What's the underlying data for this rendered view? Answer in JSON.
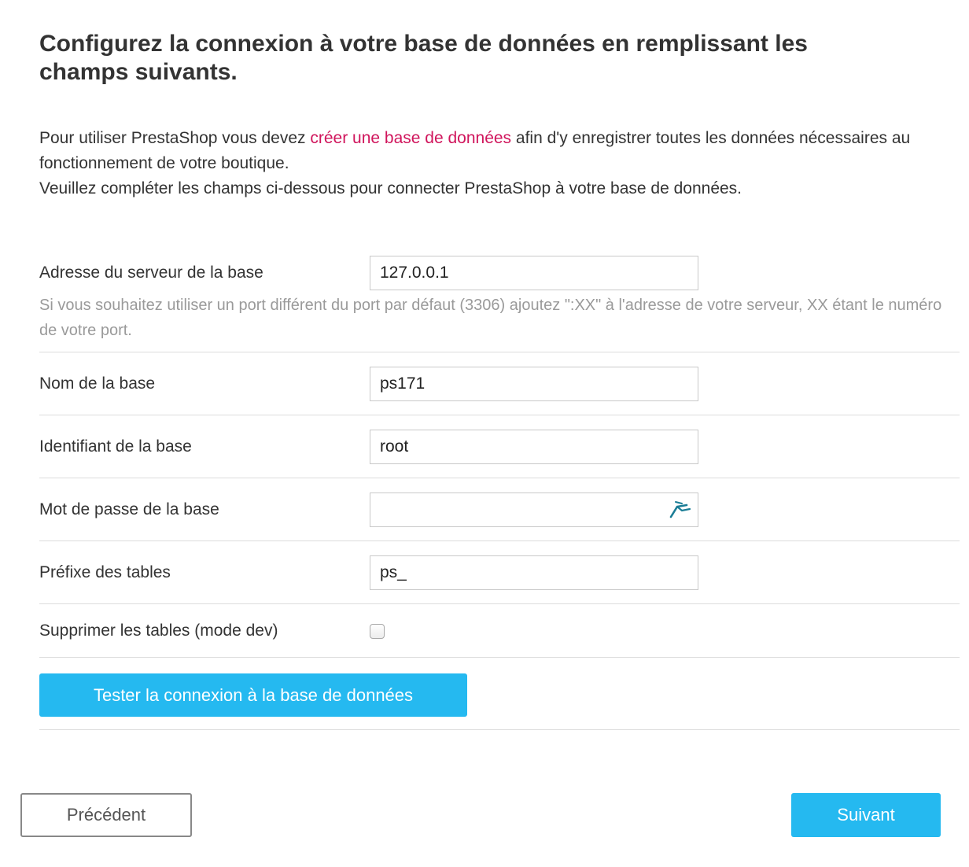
{
  "heading": "Configurez la connexion à votre base de données en remplissant les champs suivants.",
  "intro": {
    "part1": "Pour utiliser PrestaShop vous devez ",
    "link": "créer une base de données",
    "part2": " afin d'y enregistrer toutes les données nécessaires au fonctionnement de votre boutique.",
    "line2": "Veuillez compléter les champs ci-dessous pour connecter PrestaShop à votre base de données."
  },
  "fields": {
    "server": {
      "label": "Adresse du serveur de la base",
      "value": "127.0.0.1",
      "help": "Si vous souhaitez utiliser un port différent du port par défaut (3306) ajoutez \":XX\" à l'adresse de votre serveur, XX étant le numéro de votre port."
    },
    "name": {
      "label": "Nom de la base",
      "value": "ps171"
    },
    "login": {
      "label": "Identifiant de la base",
      "value": "root"
    },
    "password": {
      "label": "Mot de passe de la base",
      "value": "",
      "icon": "password-manager-key-icon"
    },
    "prefix": {
      "label": "Préfixe des tables",
      "value": "ps_"
    },
    "drop": {
      "label": "Supprimer les tables (mode dev)",
      "checked": false
    }
  },
  "buttons": {
    "test": "Tester la connexion à la base de données",
    "previous": "Précédent",
    "next": "Suivant"
  },
  "colors": {
    "accent": "#25b9f0",
    "link": "#d0155c",
    "help_text": "#9a9a9a"
  }
}
